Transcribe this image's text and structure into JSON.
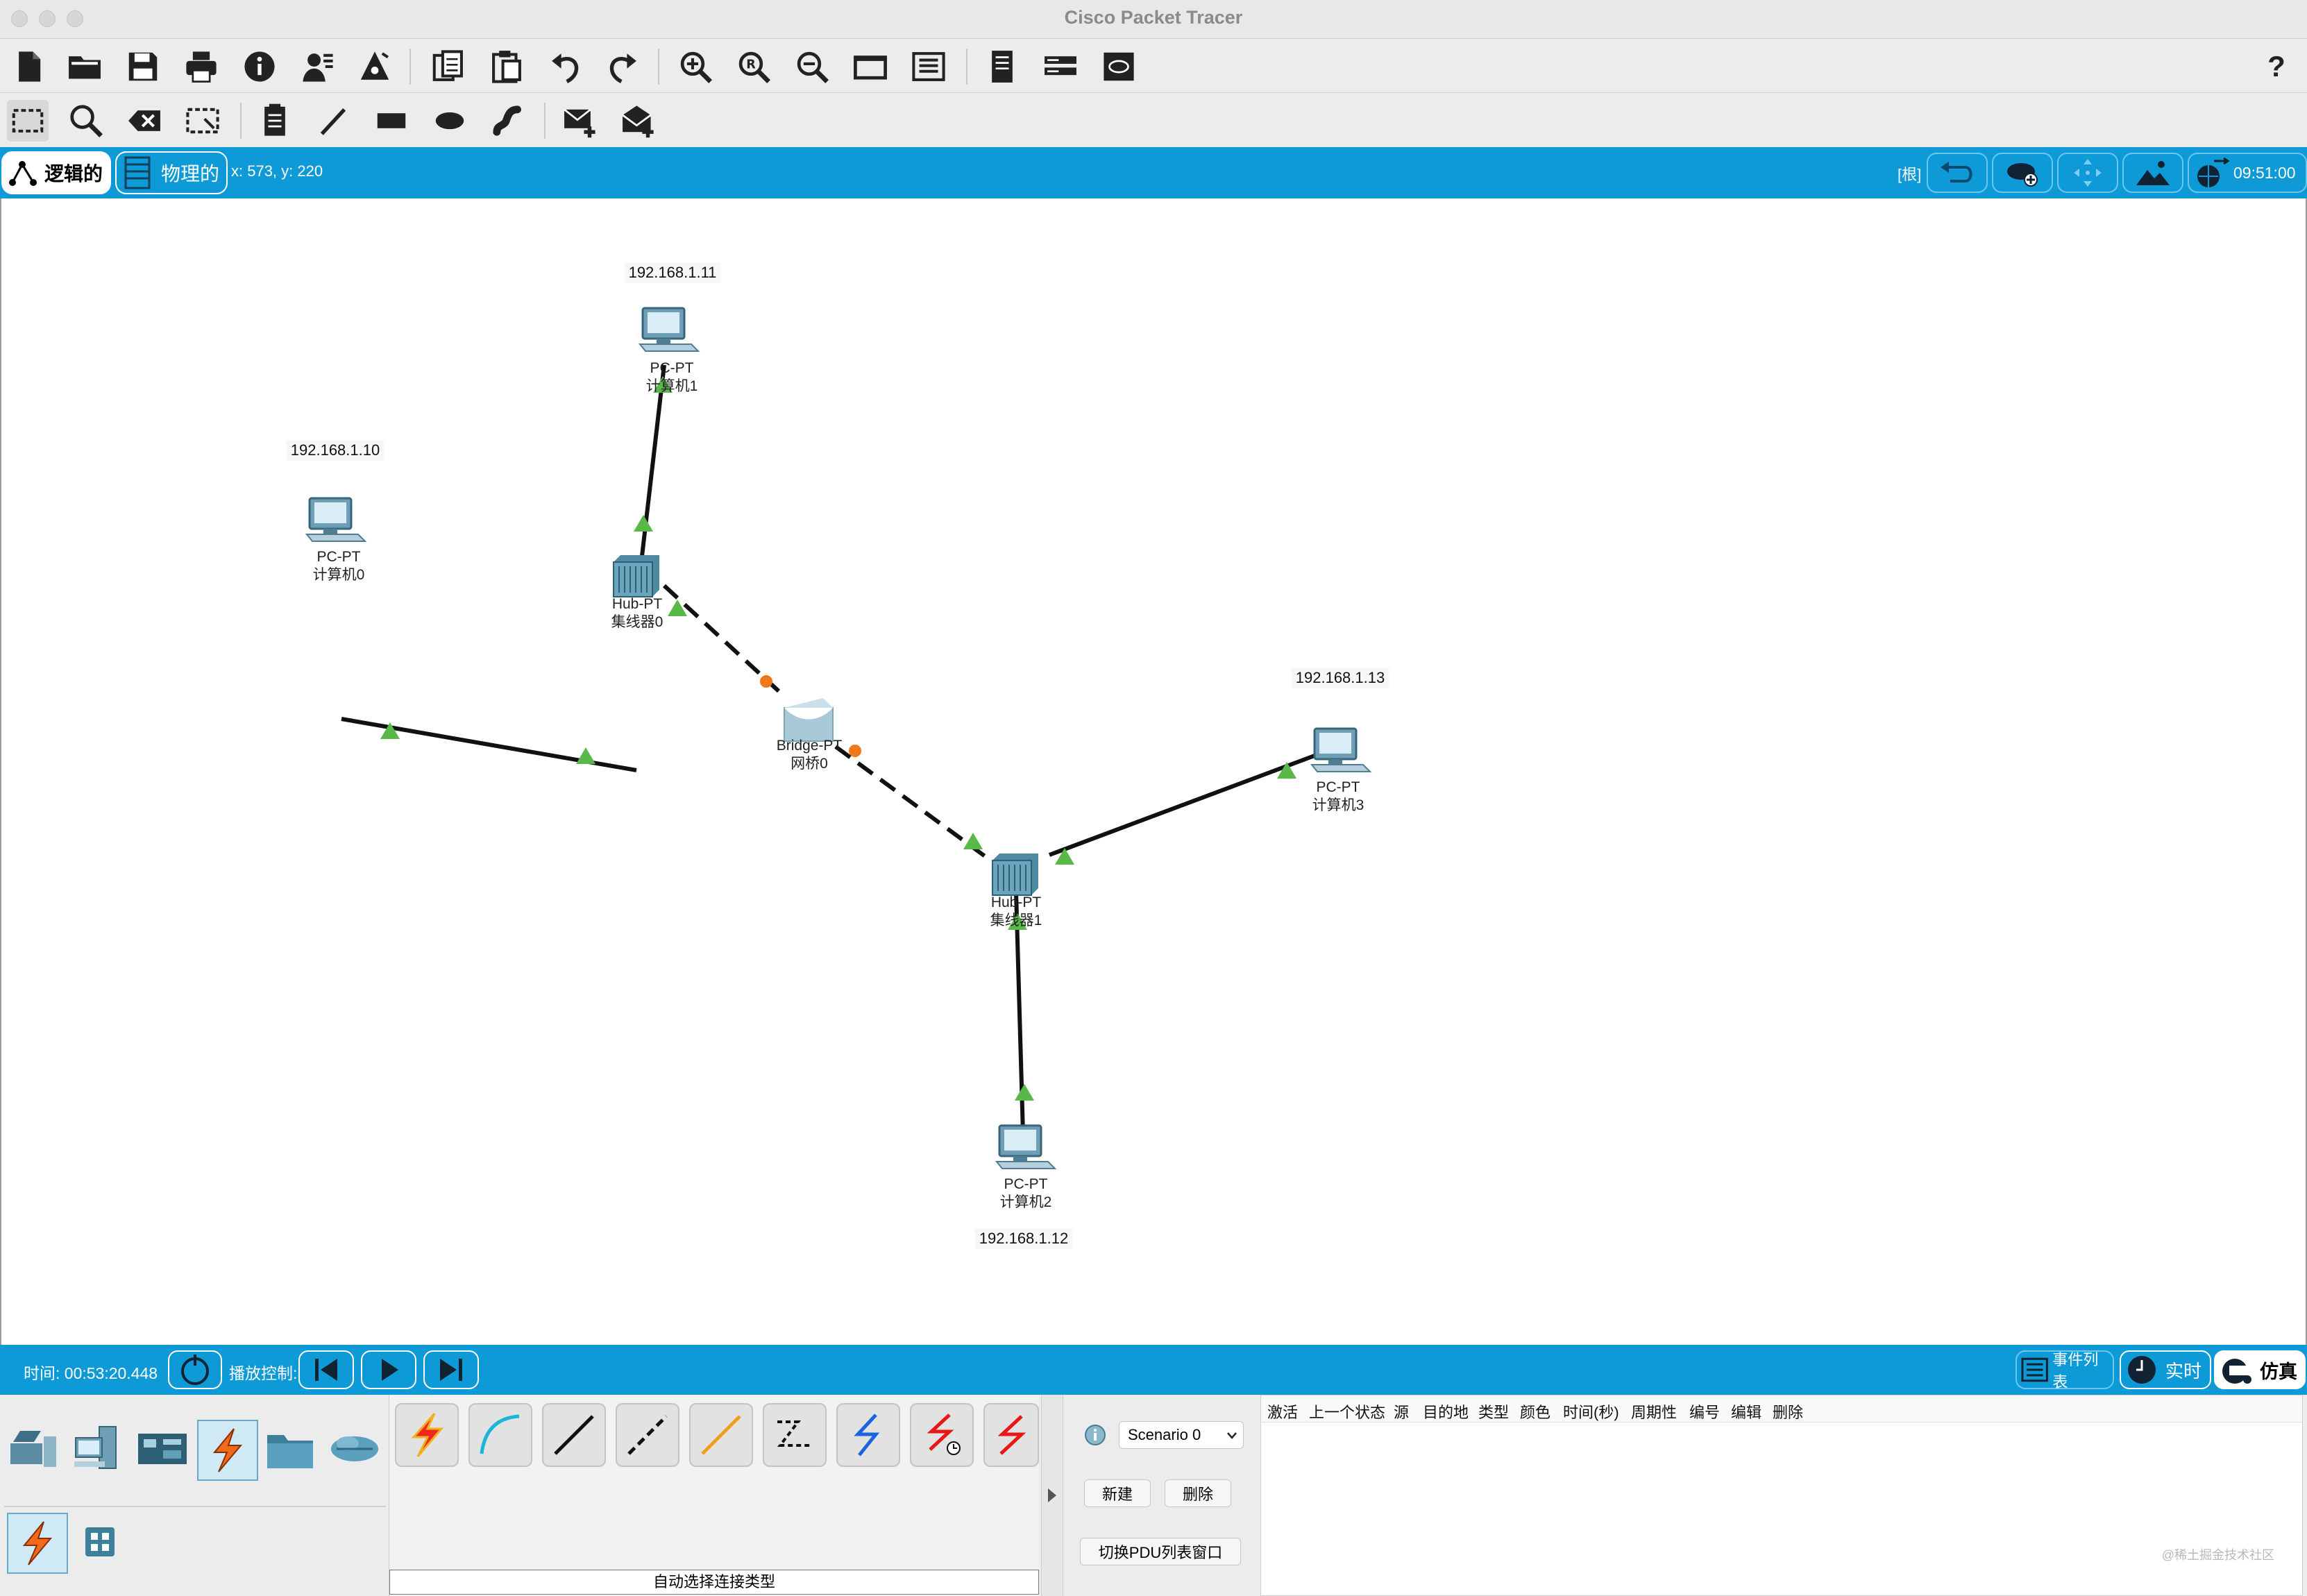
{
  "window": {
    "title": "Cisco Packet Tracer"
  },
  "toolbar_main": {
    "icons": [
      "new-file-icon",
      "open-folder-icon",
      "save-icon",
      "print-icon",
      "info-icon",
      "activity-wizard-icon",
      "custom-device-icon",
      "copy-icon",
      "paste-icon",
      "undo-icon",
      "redo-icon",
      "zoom-in-icon",
      "zoom-reset-icon",
      "zoom-out-icon",
      "drawing-palette-icon",
      "custom-devices-dialog-icon",
      "cluster-icon",
      "view-icon",
      "workspace-icon"
    ],
    "help": "?"
  },
  "toolbar_tools": {
    "icons": [
      "select-icon",
      "inspect-icon",
      "delete-icon",
      "resize-icon",
      "place-note-icon",
      "draw-line-icon",
      "draw-rectangle-icon",
      "draw-ellipse-icon",
      "freeform-icon",
      "add-simple-pdu-icon",
      "add-complex-pdu-icon"
    ]
  },
  "mode_bar": {
    "logical_label": "逻辑的",
    "physical_label": "物理的",
    "coords": "x: 573, y: 220",
    "root_label": "[根]",
    "clock": "09:51:00"
  },
  "topology": {
    "devices": [
      {
        "id": "pc0",
        "type": "pc",
        "model": "PC-PT",
        "name": "计算机0",
        "ip": "192.168.1.10"
      },
      {
        "id": "pc1",
        "type": "pc",
        "model": "PC-PT",
        "name": "计算机1",
        "ip": "192.168.1.11"
      },
      {
        "id": "pc2",
        "type": "pc",
        "model": "PC-PT",
        "name": "计算机2",
        "ip": "192.168.1.12"
      },
      {
        "id": "pc3",
        "type": "pc",
        "model": "PC-PT",
        "name": "计算机3",
        "ip": "192.168.1.13"
      },
      {
        "id": "hub0",
        "type": "hub",
        "model": "Hub-PT",
        "name": "集线器0"
      },
      {
        "id": "hub1",
        "type": "hub",
        "model": "Hub-PT",
        "name": "集线器1"
      },
      {
        "id": "bridge0",
        "type": "bridge",
        "model": "Bridge-PT",
        "name": "网桥0"
      }
    ],
    "links": [
      {
        "from": "pc0",
        "to": "hub0",
        "style": "straight"
      },
      {
        "from": "pc1",
        "to": "hub0",
        "style": "straight"
      },
      {
        "from": "hub0",
        "to": "bridge0",
        "style": "crossover"
      },
      {
        "from": "bridge0",
        "to": "hub1",
        "style": "crossover"
      },
      {
        "from": "hub1",
        "to": "pc3",
        "style": "straight"
      },
      {
        "from": "hub1",
        "to": "pc2",
        "style": "straight"
      }
    ]
  },
  "sim_bar": {
    "time_label": "时间: 00:53:20.448",
    "playback_label": "播放控制:",
    "event_list_label": "事件列表",
    "realtime_label": "实时",
    "simulation_label": "仿真"
  },
  "device_panel": {
    "categories": [
      "network-devices-icon",
      "end-devices-icon",
      "components-icon",
      "connections-icon",
      "misc-icon",
      "multiuser-icon"
    ],
    "subcategories": [
      "connections-subcategory-icon",
      "grid-icon"
    ],
    "cables": [
      "auto-connection",
      "console",
      "copper-straight-through",
      "copper-cross-over",
      "fiber",
      "phone",
      "coaxial",
      "serial-dce",
      "serial-dte"
    ],
    "status_label": "自动选择连接类型"
  },
  "scenario_panel": {
    "scenario": "Scenario 0",
    "new_label": "新建",
    "delete_label": "删除",
    "toggle_label": "切换PDU列表窗口"
  },
  "pdu_table": {
    "columns": [
      "激活",
      "上一个状态",
      "源",
      "目的地",
      "类型",
      "颜色",
      "时间(秒)",
      "周期性",
      "编号",
      "编辑",
      "删除"
    ]
  },
  "watermark": "@稀土掘金技术社区",
  "colors": {
    "accent_blue": "#0e9ad6",
    "link_up": "#58b848",
    "link_blocking": "#f07818"
  }
}
